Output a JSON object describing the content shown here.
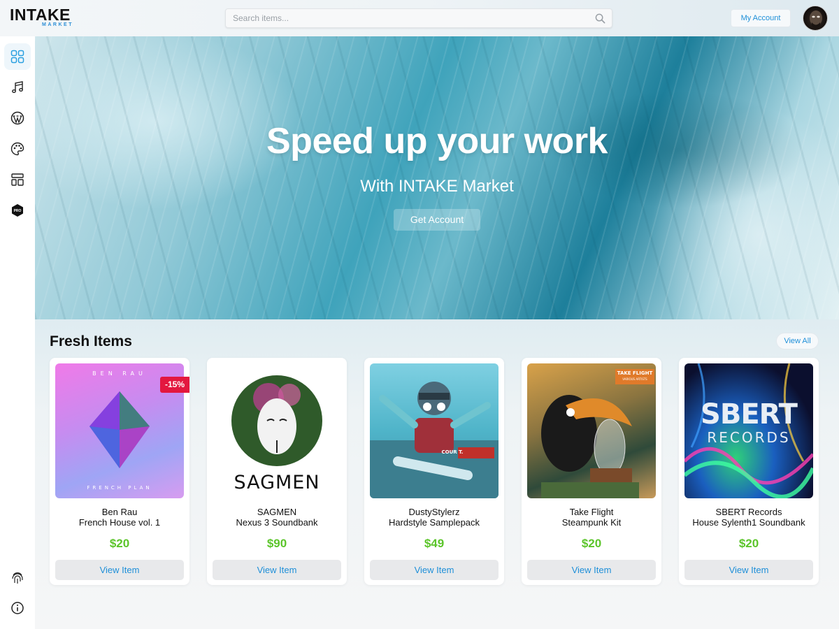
{
  "app": {
    "logo_main": "INTAKE",
    "logo_sub": "MARKET"
  },
  "header": {
    "search_placeholder": "Search items...",
    "account_label": "My Account"
  },
  "sidebar": {
    "items": [
      {
        "icon": "grid-icon",
        "active": true
      },
      {
        "icon": "music-note-icon",
        "active": false
      },
      {
        "icon": "wordpress-icon",
        "active": false
      },
      {
        "icon": "palette-icon",
        "active": false
      },
      {
        "icon": "layout-icon",
        "active": false
      },
      {
        "icon": "pro-badge-icon",
        "label": "PRO",
        "active": false
      }
    ],
    "bottom": [
      {
        "icon": "fingerprint-icon"
      },
      {
        "icon": "info-icon"
      }
    ]
  },
  "hero": {
    "title": "Speed up your work",
    "subtitle": "With INTAKE Market",
    "button": "Get Account"
  },
  "fresh": {
    "title": "Fresh Items",
    "view_all": "View All",
    "items": [
      {
        "artist": "Ben Rau",
        "title": "French House vol. 1",
        "price": "$20",
        "button": "View Item",
        "badge": "-15%",
        "cover_top": "BEN RAU",
        "cover_bottom": "FRENCH PLAN"
      },
      {
        "artist": "SAGMEN",
        "title": "Nexus 3 Soundbank",
        "price": "$90",
        "button": "View Item",
        "cover_text": "SAGMEN"
      },
      {
        "artist": "DustyStylerz",
        "title": "Hardstyle Samplepack",
        "price": "$49",
        "button": "View Item",
        "cover_text": "COUR T."
      },
      {
        "artist": "Take Flight",
        "title": "Steampunk Kit",
        "price": "$20",
        "button": "View Item",
        "cover_text": "TAKE FLIGHT",
        "cover_sub": "VARIOUS ARTISTS"
      },
      {
        "artist": "SBERT Records",
        "title": "House Sylenth1 Soundbank",
        "price": "$20",
        "button": "View Item",
        "cover_text": "SBERT",
        "cover_sub": "RECORDS"
      }
    ]
  },
  "colors": {
    "accent": "#1e8fd8",
    "price": "#5cc52b",
    "badge": "#e3173f"
  }
}
